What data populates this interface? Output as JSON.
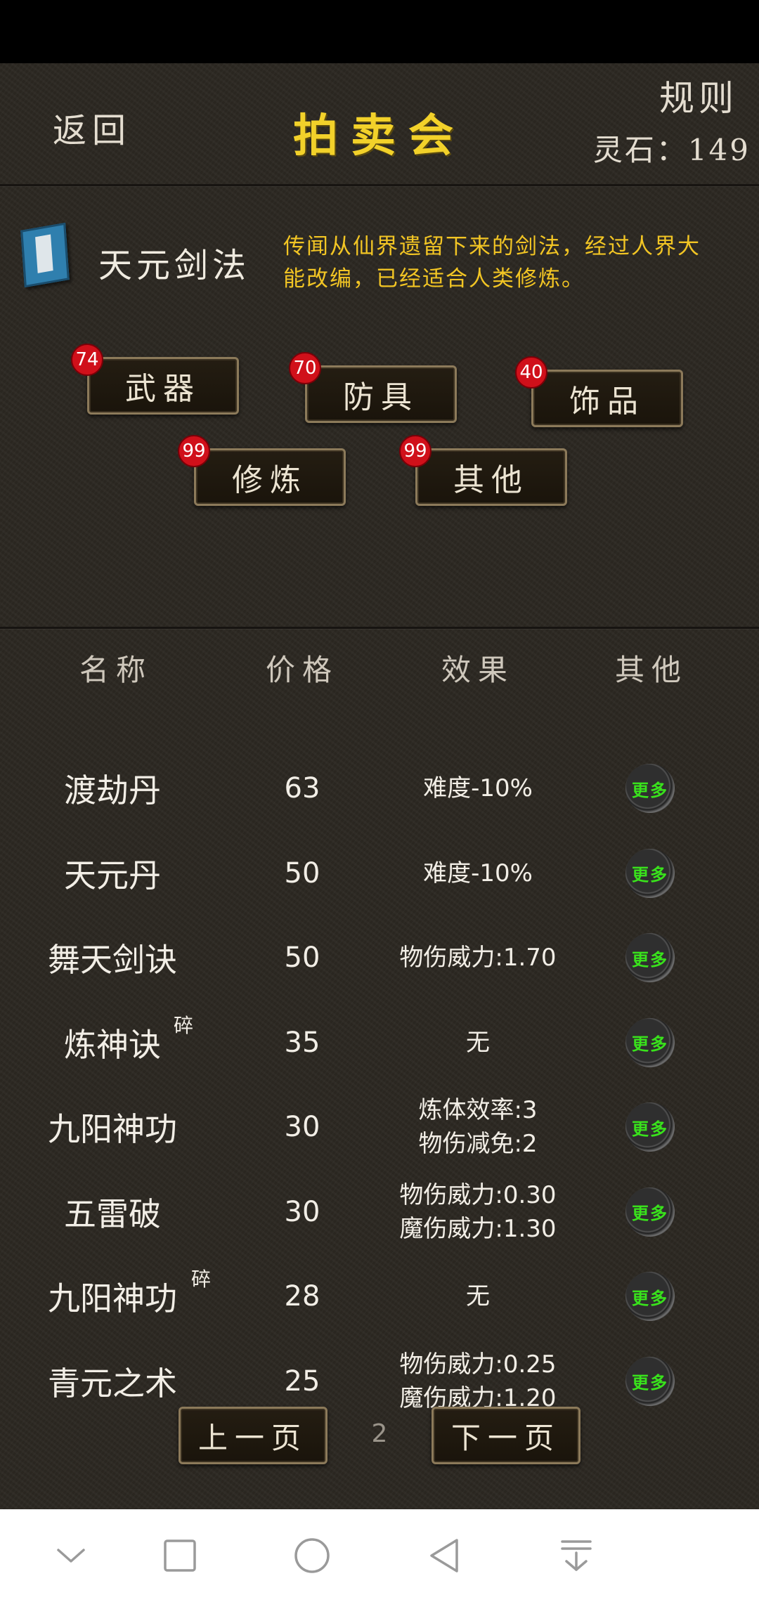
{
  "header": {
    "back_label": "返回",
    "title": "拍卖会",
    "rules_label": "规则",
    "stones_label": "灵石：149"
  },
  "featured": {
    "icon": "book-icon",
    "name": "天元剑法",
    "description": "传闻从仙界遗留下来的剑法，经过人界大能改编，已经适合人类修炼。"
  },
  "categories": [
    {
      "label": "武器",
      "count": "74"
    },
    {
      "label": "防具",
      "count": "70"
    },
    {
      "label": "饰品",
      "count": "40"
    },
    {
      "label": "修炼",
      "count": "99"
    },
    {
      "label": "其他",
      "count": "99"
    }
  ],
  "table": {
    "headers": [
      "名称",
      "价格",
      "效果",
      "其他"
    ],
    "more_label": "更多",
    "fragment_mark": "碎",
    "rows": [
      {
        "name": "渡劫丹",
        "price": "63",
        "effect1": "难度-10%",
        "effect2": "",
        "fragment": false
      },
      {
        "name": "天元丹",
        "price": "50",
        "effect1": "难度-10%",
        "effect2": "",
        "fragment": false
      },
      {
        "name": "舞天剑诀",
        "price": "50",
        "effect1": "物伤威力:1.70",
        "effect2": "",
        "fragment": false
      },
      {
        "name": "炼神诀",
        "price": "35",
        "effect1": "无",
        "effect2": "",
        "fragment": true
      },
      {
        "name": "九阳神功",
        "price": "30",
        "effect1": "炼体效率:3",
        "effect2": "物伤减免:2",
        "fragment": false
      },
      {
        "name": "五雷破",
        "price": "30",
        "effect1": "物伤威力:0.30",
        "effect2": "魔伤威力:1.30",
        "fragment": false
      },
      {
        "name": "九阳神功",
        "price": "28",
        "effect1": "无",
        "effect2": "",
        "fragment": true
      },
      {
        "name": "青元之术",
        "price": "25",
        "effect1": "物伤威力:0.25",
        "effect2": "魔伤威力:1.20",
        "fragment": false
      }
    ]
  },
  "pager": {
    "prev_label": "上一页",
    "next_label": "下一页",
    "page": "2"
  },
  "colors": {
    "title": "#f2d12a",
    "description": "#f2c524",
    "badge": "#d0101a",
    "more_text": "#39e21c"
  },
  "navbar": {
    "icons": [
      "chevron-down-icon",
      "square-icon",
      "circle-icon",
      "back-triangle-icon",
      "pull-down-icon"
    ]
  }
}
